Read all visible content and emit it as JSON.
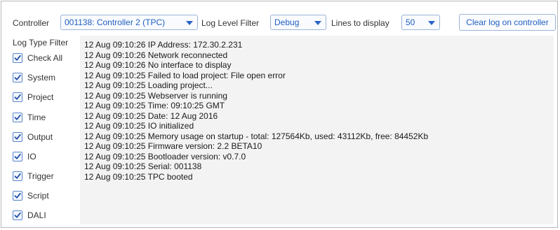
{
  "toolbar": {
    "controller_label": "Controller",
    "controller_value": "001138: Controller 2 (TPC)",
    "log_level_label": "Log Level Filter",
    "log_level_value": "Debug",
    "lines_label": "Lines to display",
    "lines_value": "50",
    "clear_button": "Clear log on controller"
  },
  "filter": {
    "title": "Log Type Filter",
    "items": [
      {
        "label": "Check All",
        "checked": true
      },
      {
        "label": "System",
        "checked": true
      },
      {
        "label": "Project",
        "checked": true
      },
      {
        "label": "Time",
        "checked": true
      },
      {
        "label": "Output",
        "checked": true
      },
      {
        "label": "IO",
        "checked": true
      },
      {
        "label": "Trigger",
        "checked": true
      },
      {
        "label": "Script",
        "checked": true
      },
      {
        "label": "DALI",
        "checked": true
      }
    ]
  },
  "log": {
    "lines": [
      "12 Aug 09:10:26 IP Address: 172.30.2.231",
      "12 Aug 09:10:26 Network reconnected",
      "12 Aug 09:10:26 No interface to display",
      "12 Aug 09:10:25 Failed to load project: File open error",
      "12 Aug 09:10:25 Loading project...",
      "12 Aug 09:10:25 Webserver is running",
      "12 Aug 09:10:25 Time: 09:10:25 GMT",
      "12 Aug 09:10:25 Date: 12 Aug 2016",
      "12 Aug 09:10:25 IO initialized",
      "12 Aug 09:10:25 Memory usage on startup - total: 127564Kb, used: 43112Kb, free: 84452Kb",
      "12 Aug 09:10:25 Firmware version: 2.2 BETA10",
      "12 Aug 09:10:25 Bootloader version: v0.7.0",
      "12 Aug 09:10:25 Serial: 001138",
      "12 Aug 09:10:25 TPC booted"
    ]
  },
  "colors": {
    "accent": "#1f5fbf",
    "log_background": "#f3f3f3"
  }
}
